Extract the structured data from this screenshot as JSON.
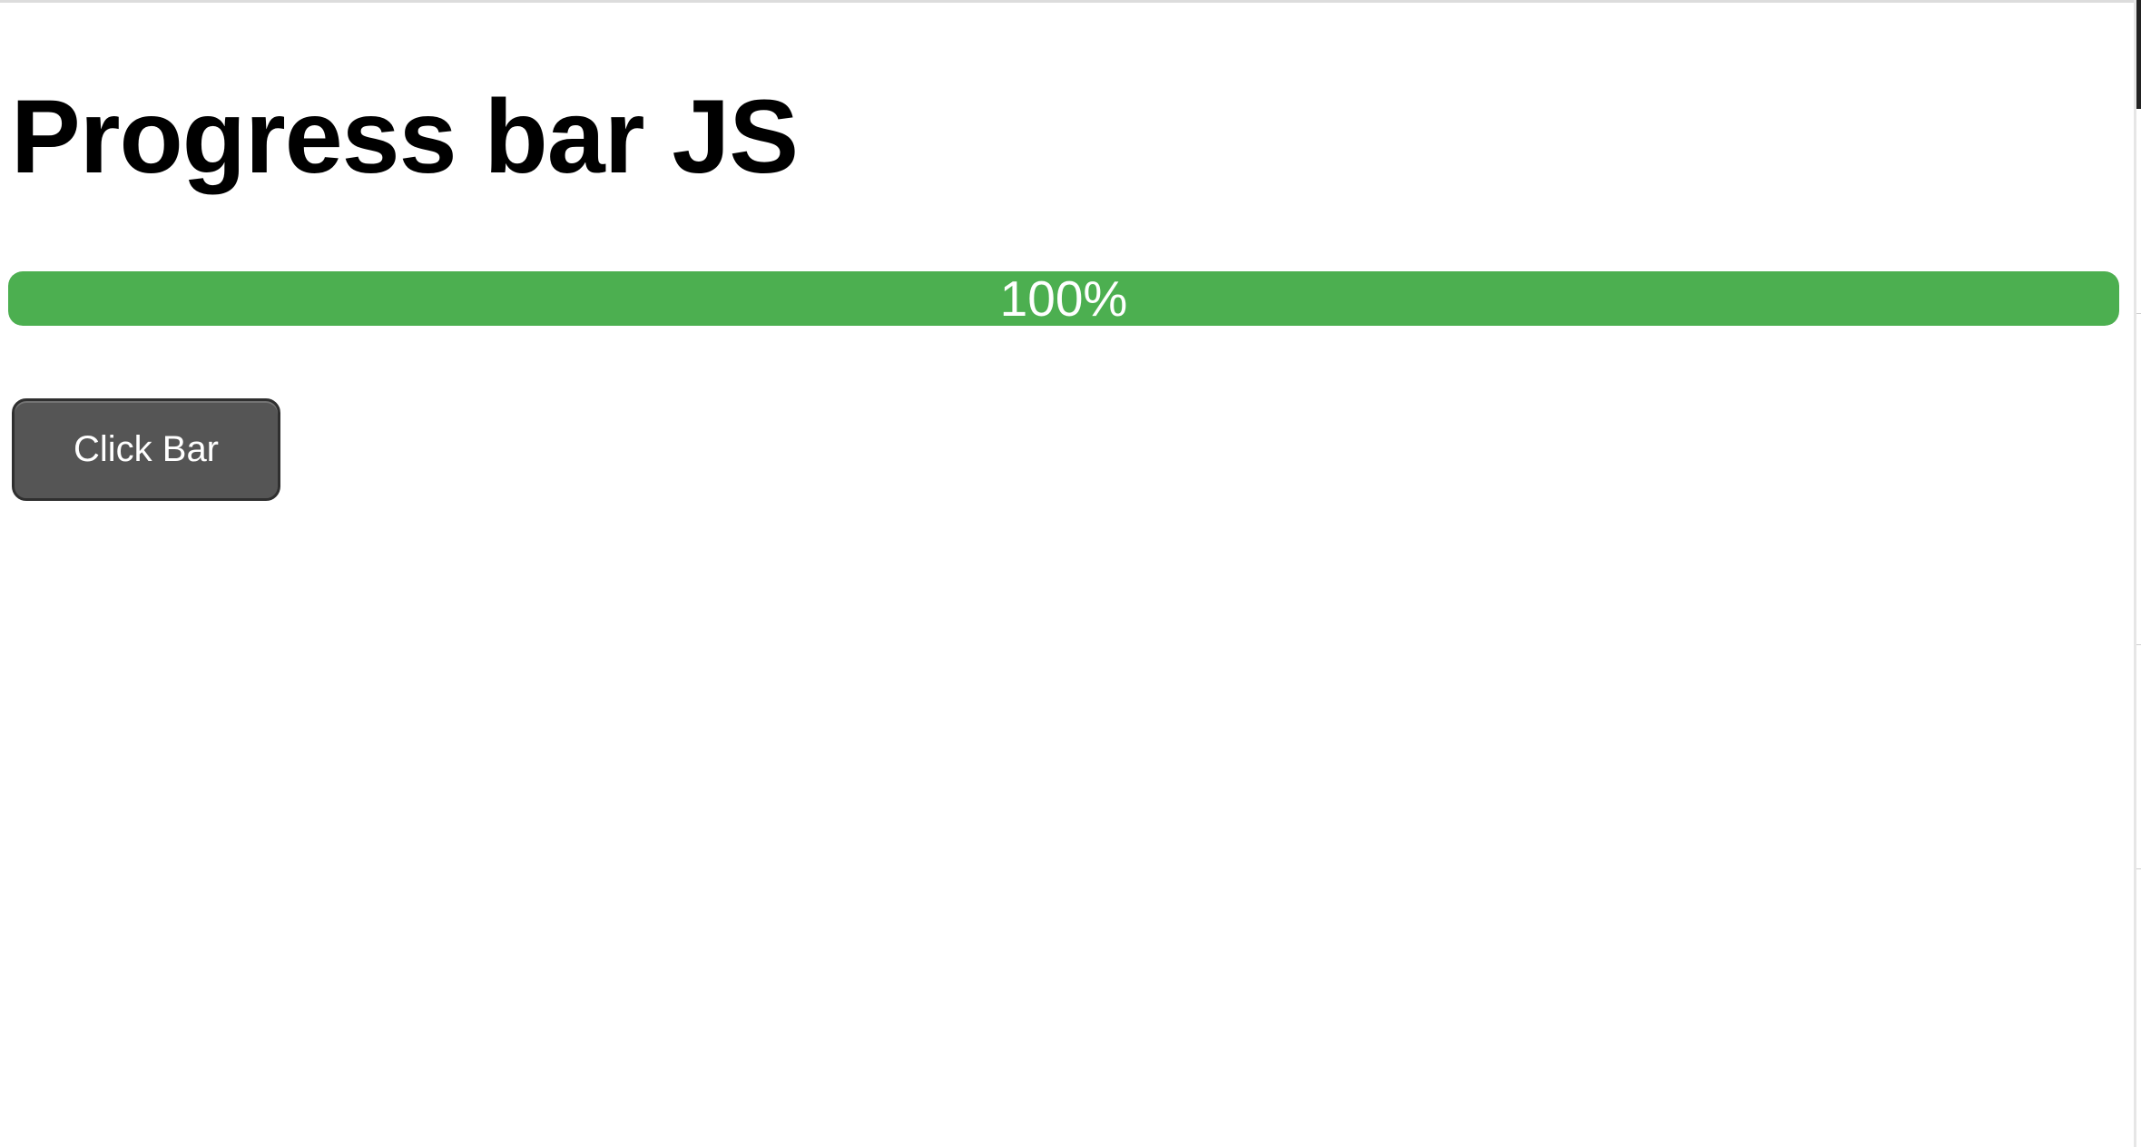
{
  "page": {
    "title": "Progress bar JS"
  },
  "progress": {
    "value_percent": 100,
    "label": "100%",
    "fill_color": "#4caf50",
    "track_color": "#dddddd"
  },
  "controls": {
    "click_bar_label": "Click Bar",
    "button_color": "#555555"
  }
}
